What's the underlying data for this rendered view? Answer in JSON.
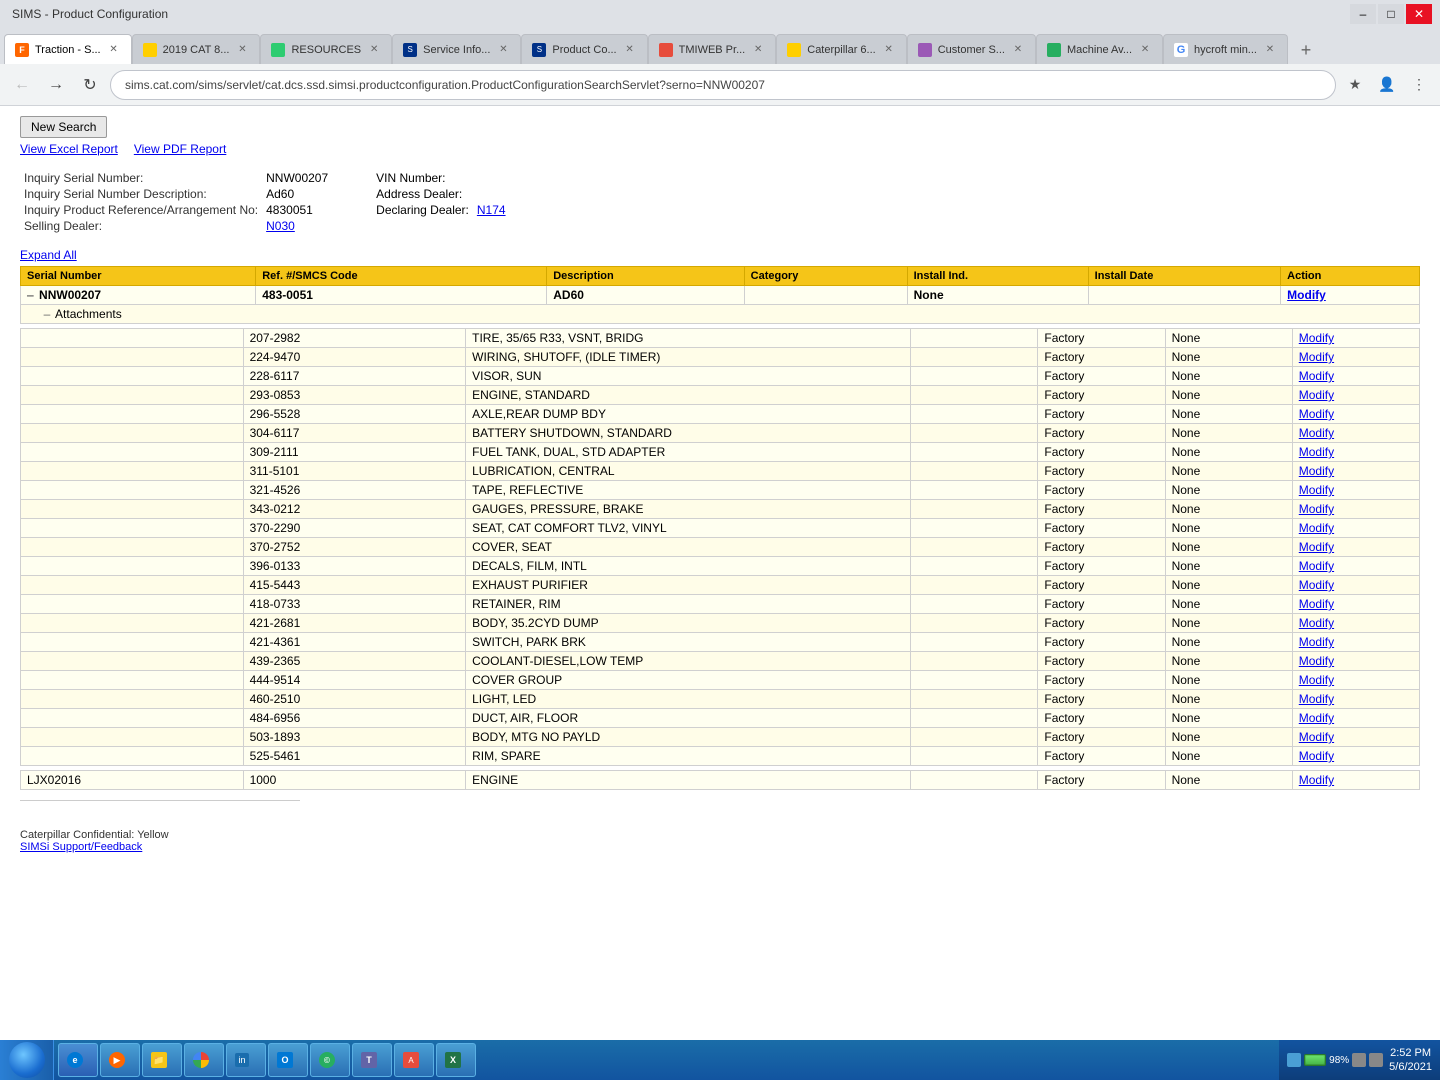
{
  "browser": {
    "title": "SIMS - Product Configuration",
    "url": "sims.cat.com/sims/servlet/cat.dcs.ssd.simsi.productconfiguration.ProductConfigurationSearchServlet?serno=NNW00207",
    "tabs": [
      {
        "id": "traction",
        "label": "Traction - S...",
        "favicon": "F",
        "favicon_type": "f",
        "active": true
      },
      {
        "id": "cat2019",
        "label": "2019 CAT 8...",
        "favicon": "cat",
        "favicon_type": "cat",
        "active": false
      },
      {
        "id": "resources",
        "label": "RESOURCES",
        "favicon": "res",
        "favicon_type": "res",
        "active": false
      },
      {
        "id": "service",
        "label": "Service Info...",
        "favicon": "sims",
        "favicon_type": "sims",
        "active": false
      },
      {
        "id": "productco",
        "label": "Product Co...",
        "favicon": "sims",
        "favicon_type": "sims",
        "active": false
      },
      {
        "id": "tmiweb",
        "label": "TMIWEB Pr...",
        "favicon": "tmiweb",
        "favicon_type": "tmiweb",
        "active": false
      },
      {
        "id": "caterpillar",
        "label": "Caterpillar 6...",
        "favicon": "cat",
        "favicon_type": "cat",
        "active": false
      },
      {
        "id": "customer",
        "label": "Customer S...",
        "favicon": "cust",
        "favicon_type": "cust",
        "active": false
      },
      {
        "id": "machine",
        "label": "Machine Av...",
        "favicon": "mach",
        "favicon_type": "mach",
        "active": false
      },
      {
        "id": "hycroft",
        "label": "hycroft min...",
        "favicon": "G",
        "favicon_type": "g",
        "active": false
      }
    ]
  },
  "page": {
    "buttons": {
      "new_search": "New Search",
      "view_excel": "View Excel Report",
      "view_pdf": "View PDF Report"
    },
    "inquiry": {
      "serial_number_label": "Inquiry Serial Number:",
      "serial_number_value": "NNW00207",
      "description_label": "Inquiry Serial Number Description:",
      "description_value": "Ad60",
      "arrangement_label": "Inquiry Product Reference/Arrangement No:",
      "arrangement_value": "4830051",
      "selling_dealer_label": "Selling Dealer:",
      "selling_dealer_value": "N030",
      "vin_number_label": "VIN Number:",
      "vin_number_value": "",
      "address_dealer_label": "Address Dealer:",
      "address_dealer_value": "",
      "declaring_dealer_label": "Declaring Dealer:",
      "declaring_dealer_value": "N174"
    },
    "expand_all": "Expand All",
    "table_headers": {
      "serial_number": "Serial Number",
      "ref_smcs": "Ref. #/SMCS Code",
      "description": "Description",
      "category": "Category",
      "install_ind": "Install Ind.",
      "install_date": "Install Date",
      "action": "Action"
    },
    "serial_root": {
      "serial": "NNW00207",
      "ref": "483-0051",
      "description": "AD60",
      "category": "",
      "install_ind": "None",
      "install_date": "",
      "action": "Modify",
      "attachments_label": "Attachments"
    },
    "rows": [
      {
        "ref": "207-2982",
        "description": "TIRE, 35/65 R33, VSNT, BRIDG",
        "category": "",
        "install_ind": "Factory",
        "install_date": "None",
        "action": "Modify"
      },
      {
        "ref": "224-9470",
        "description": "WIRING, SHUTOFF, (IDLE TIMER)",
        "category": "",
        "install_ind": "Factory",
        "install_date": "None",
        "action": "Modify"
      },
      {
        "ref": "228-6117",
        "description": "VISOR, SUN",
        "category": "",
        "install_ind": "Factory",
        "install_date": "None",
        "action": "Modify"
      },
      {
        "ref": "293-0853",
        "description": "ENGINE, STANDARD",
        "category": "",
        "install_ind": "Factory",
        "install_date": "None",
        "action": "Modify"
      },
      {
        "ref": "296-5528",
        "description": "AXLE,REAR DUMP BDY",
        "category": "",
        "install_ind": "Factory",
        "install_date": "None",
        "action": "Modify"
      },
      {
        "ref": "304-6117",
        "description": "BATTERY SHUTDOWN, STANDARD",
        "category": "",
        "install_ind": "Factory",
        "install_date": "None",
        "action": "Modify"
      },
      {
        "ref": "309-2111",
        "description": "FUEL TANK, DUAL, STD ADAPTER",
        "category": "",
        "install_ind": "Factory",
        "install_date": "None",
        "action": "Modify"
      },
      {
        "ref": "311-5101",
        "description": "LUBRICATION, CENTRAL",
        "category": "",
        "install_ind": "Factory",
        "install_date": "None",
        "action": "Modify"
      },
      {
        "ref": "321-4526",
        "description": "TAPE, REFLECTIVE",
        "category": "",
        "install_ind": "Factory",
        "install_date": "None",
        "action": "Modify"
      },
      {
        "ref": "343-0212",
        "description": "GAUGES, PRESSURE, BRAKE",
        "category": "",
        "install_ind": "Factory",
        "install_date": "None",
        "action": "Modify"
      },
      {
        "ref": "370-2290",
        "description": "SEAT, CAT COMFORT TLV2, VINYL",
        "category": "",
        "install_ind": "Factory",
        "install_date": "None",
        "action": "Modify"
      },
      {
        "ref": "370-2752",
        "description": "COVER, SEAT",
        "category": "",
        "install_ind": "Factory",
        "install_date": "None",
        "action": "Modify"
      },
      {
        "ref": "396-0133",
        "description": "DECALS, FILM, INTL",
        "category": "",
        "install_ind": "Factory",
        "install_date": "None",
        "action": "Modify"
      },
      {
        "ref": "415-5443",
        "description": "EXHAUST PURIFIER",
        "category": "",
        "install_ind": "Factory",
        "install_date": "None",
        "action": "Modify"
      },
      {
        "ref": "418-0733",
        "description": "RETAINER, RIM",
        "category": "",
        "install_ind": "Factory",
        "install_date": "None",
        "action": "Modify"
      },
      {
        "ref": "421-2681",
        "description": "BODY, 35.2CYD DUMP",
        "category": "",
        "install_ind": "Factory",
        "install_date": "None",
        "action": "Modify"
      },
      {
        "ref": "421-4361",
        "description": "SWITCH, PARK BRK",
        "category": "",
        "install_ind": "Factory",
        "install_date": "None",
        "action": "Modify"
      },
      {
        "ref": "439-2365",
        "description": "COOLANT-DIESEL,LOW TEMP",
        "category": "",
        "install_ind": "Factory",
        "install_date": "None",
        "action": "Modify"
      },
      {
        "ref": "444-9514",
        "description": "COVER GROUP",
        "category": "",
        "install_ind": "Factory",
        "install_date": "None",
        "action": "Modify"
      },
      {
        "ref": "460-2510",
        "description": "LIGHT, LED",
        "category": "",
        "install_ind": "Factory",
        "install_date": "None",
        "action": "Modify"
      },
      {
        "ref": "484-6956",
        "description": "DUCT, AIR, FLOOR",
        "category": "",
        "install_ind": "Factory",
        "install_date": "None",
        "action": "Modify"
      },
      {
        "ref": "503-1893",
        "description": "BODY, MTG NO PAYLD",
        "category": "",
        "install_ind": "Factory",
        "install_date": "None",
        "action": "Modify"
      },
      {
        "ref": "525-5461",
        "description": "RIM, SPARE",
        "category": "",
        "install_ind": "Factory",
        "install_date": "None",
        "action": "Modify"
      }
    ],
    "ljx_row": {
      "serial": "LJX02016",
      "ref": "1000",
      "description": "ENGINE",
      "category": "",
      "install_ind": "Factory",
      "install_date": "None",
      "action": "Modify"
    },
    "footer": {
      "confidential": "Caterpillar Confidential:",
      "confidential_level": "Yellow",
      "support_link": "SIMSi Support/Feedback"
    }
  },
  "taskbar": {
    "time": "2:52 PM",
    "date": "5/6/2021",
    "battery_pct": "98%",
    "apps": [
      {
        "label": "Windows",
        "icon": "win"
      },
      {
        "label": "IE",
        "icon": "ie"
      },
      {
        "label": "Media",
        "icon": "media"
      },
      {
        "label": "Folder",
        "icon": "folder"
      },
      {
        "label": "Chrome",
        "icon": "chrome"
      },
      {
        "label": "Infor",
        "icon": "infor"
      },
      {
        "label": "Outlook",
        "icon": "outlook"
      },
      {
        "label": "CDI",
        "icon": "cdi"
      },
      {
        "label": "Teams",
        "icon": "teams"
      },
      {
        "label": "App",
        "icon": "app"
      },
      {
        "label": "Excel",
        "icon": "excel"
      }
    ]
  }
}
